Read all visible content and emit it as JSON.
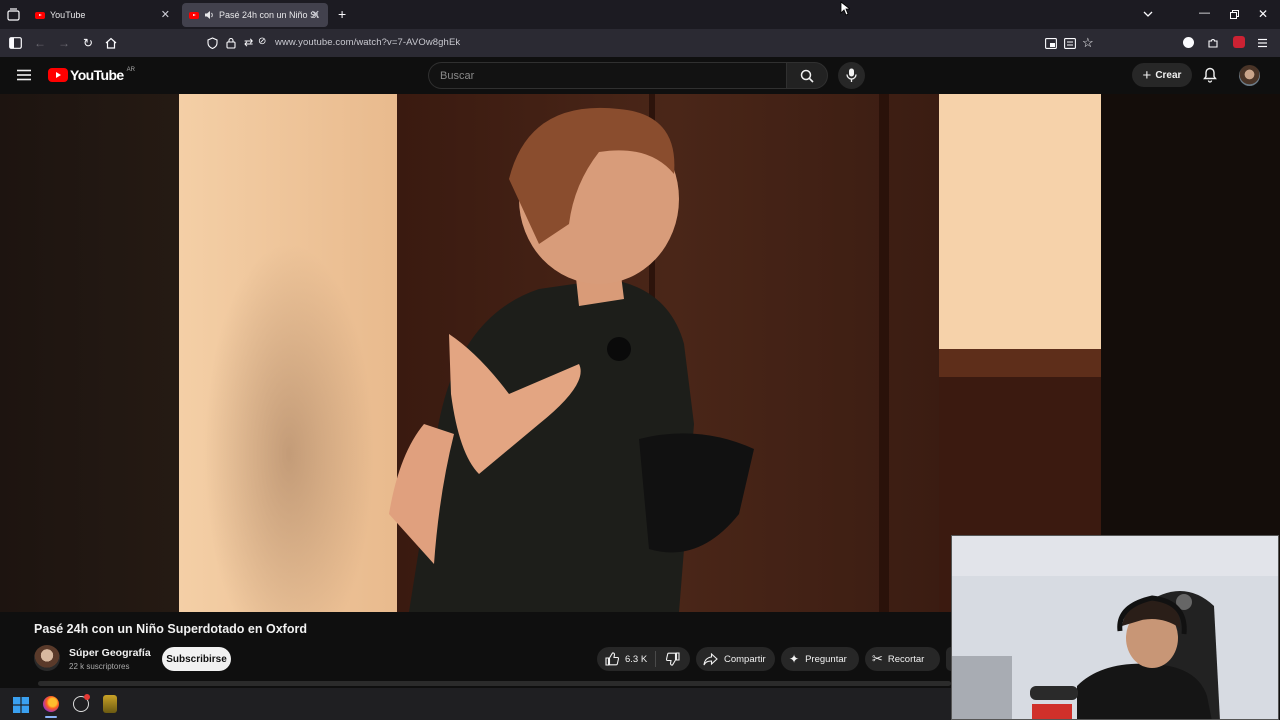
{
  "browser": {
    "tabs": [
      {
        "title": "YouTube",
        "active": false
      },
      {
        "title": "Pasé 24h con un Niño Supe",
        "active": true
      }
    ],
    "url": "www.youtube.com/watch?v=7-AVOw8ghEk"
  },
  "youtube": {
    "logo_text": "YouTube",
    "region": "AR",
    "search_placeholder": "Buscar",
    "create_label": "Crear"
  },
  "video": {
    "title": "Pasé 24h con un Niño Superdotado en Oxford",
    "channel": "Súper Geografía",
    "subscribers": "22 k suscriptores",
    "subscribe_label": "Subscribirse",
    "likes": "6.3 K",
    "share_label": "Compartir",
    "ask_label": "Preguntar",
    "clip_label": "Recortar"
  },
  "colors": {
    "brand_red": "#ff0000",
    "page_bg": "#0f0f0f",
    "pill_bg": "#272727"
  }
}
